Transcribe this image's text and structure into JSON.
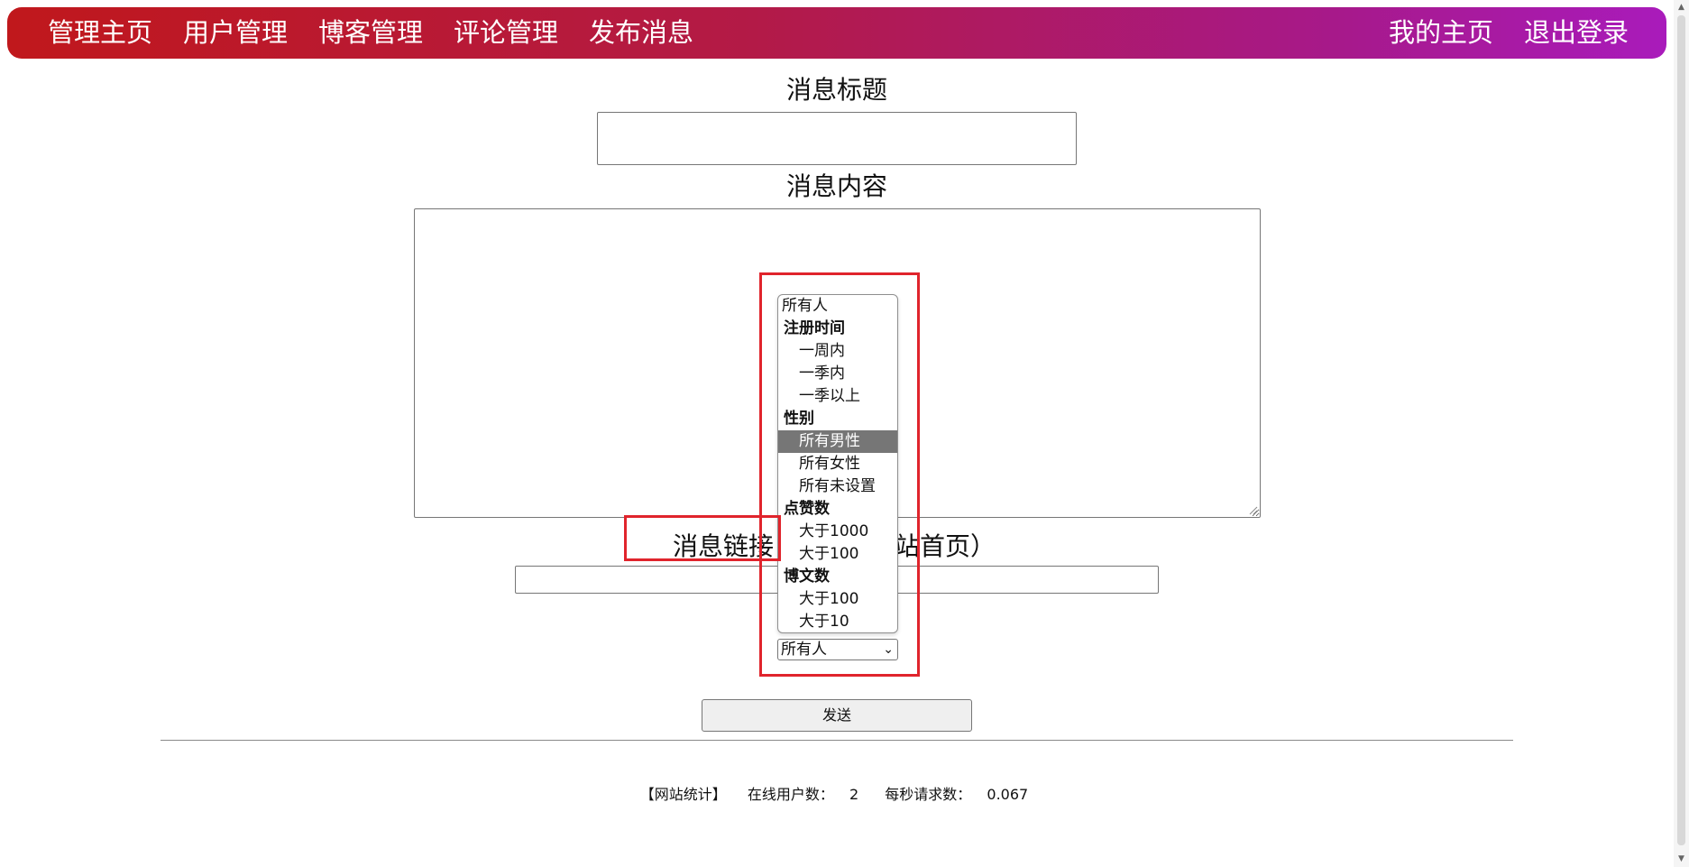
{
  "nav": {
    "left": [
      "管理主页",
      "用户管理",
      "博客管理",
      "评论管理",
      "发布消息"
    ],
    "right": [
      "我的主页",
      "退出登录"
    ]
  },
  "form": {
    "title_label": "消息标题",
    "title_value": "",
    "content_label": "消息内容",
    "content_value": "",
    "link_label_visible": "消息链接",
    "link_label_tail": "站首页）",
    "link_value": ""
  },
  "audience_select": {
    "selected": "所有人",
    "options": [
      {
        "label": "所有人",
        "kind": "top"
      },
      {
        "label": "注册时间",
        "kind": "group"
      },
      {
        "label": "一周内",
        "kind": "sub"
      },
      {
        "label": "一季内",
        "kind": "sub"
      },
      {
        "label": "一季以上",
        "kind": "sub"
      },
      {
        "label": "性别",
        "kind": "group"
      },
      {
        "label": "所有男性",
        "kind": "sub",
        "highlighted": true
      },
      {
        "label": "所有女性",
        "kind": "sub"
      },
      {
        "label": "所有未设置",
        "kind": "sub"
      },
      {
        "label": "点赞数",
        "kind": "group"
      },
      {
        "label": "大于1000",
        "kind": "sub"
      },
      {
        "label": "大于100",
        "kind": "sub"
      },
      {
        "label": "博文数",
        "kind": "group"
      },
      {
        "label": "大于100",
        "kind": "sub"
      },
      {
        "label": "大于10",
        "kind": "sub"
      }
    ]
  },
  "send_button": "发送",
  "footer": {
    "title": "【网站统计】",
    "online_label": "在线用户数：",
    "online_value": "2",
    "rps_label": "每秒请求数：",
    "rps_value": "0.067"
  },
  "colors": {
    "nav_start": "#c0181c",
    "nav_end": "#a91bbb",
    "annotation": "#e0242c",
    "highlight": "#767676"
  }
}
